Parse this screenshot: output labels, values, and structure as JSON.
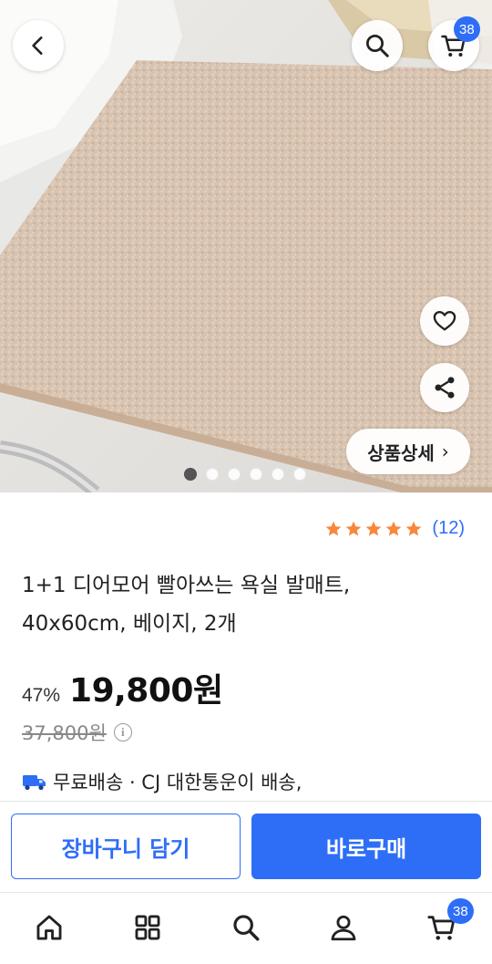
{
  "header": {
    "back_icon": "chevron-left-icon",
    "search_icon": "search-icon",
    "cart_icon": "cart-icon",
    "cart_count": "38"
  },
  "gallery": {
    "detail_label": "상품상세",
    "detail_arrow": "›",
    "slide_count": 6,
    "active_slide": 1,
    "like_icon": "heart-icon",
    "share_icon": "share-icon"
  },
  "product": {
    "rating": 5,
    "review_count": "(12)",
    "title": "1+1 디어모어 빨아쓰는 욕실 발매트, 40x60cm, 베이지, 2개",
    "discount": "47%",
    "price": "19,800원",
    "original_price": "37,800원",
    "info_icon": "info-icon",
    "shipping_icon": "truck-icon",
    "shipping_text": "무료배송 · CJ 대한통운이 배송,"
  },
  "actions": {
    "add_to_cart": "장바구니 담기",
    "buy_now": "바로구매"
  },
  "bottom_nav": {
    "items": [
      "home-icon",
      "category-icon",
      "search-icon",
      "my-icon",
      "cart-icon"
    ],
    "cart_count": "38"
  },
  "colors": {
    "accent": "#2e6ef7",
    "star": "#f7883c",
    "rug": "#d9c4b1"
  }
}
